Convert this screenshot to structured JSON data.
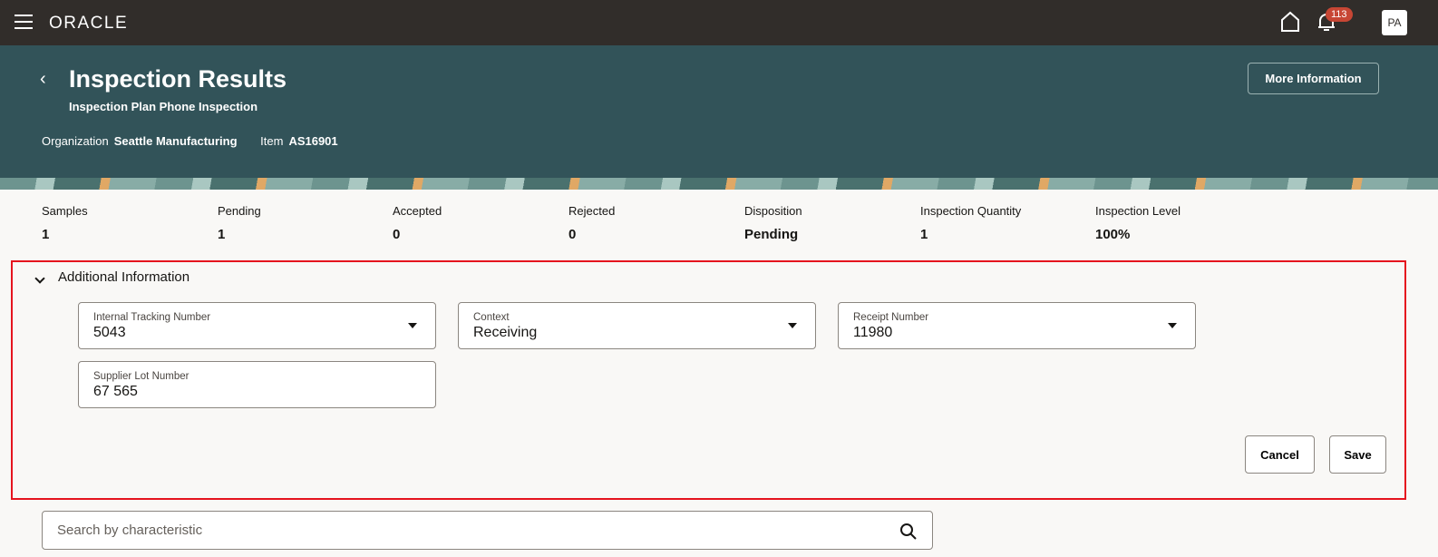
{
  "topbar": {
    "brand": "ORACLE",
    "notifications": "113",
    "user_initials": "PA"
  },
  "header": {
    "title": "Inspection Results",
    "subtitle": "Inspection Plan Phone Inspection",
    "org_label": "Organization",
    "org_value": "Seattle Manufacturing",
    "item_label": "Item",
    "item_value": "AS16901",
    "more_info": "More Information"
  },
  "stats": [
    {
      "label": "Samples",
      "value": "1"
    },
    {
      "label": "Pending",
      "value": "1"
    },
    {
      "label": "Accepted",
      "value": "0"
    },
    {
      "label": "Rejected",
      "value": "0"
    },
    {
      "label": "Disposition",
      "value": "Pending"
    },
    {
      "label": "Inspection Quantity",
      "value": "1"
    },
    {
      "label": "Inspection Level",
      "value": "100%"
    }
  ],
  "additional": {
    "title": "Additional Information",
    "fields": [
      {
        "label": "Internal Tracking Number",
        "value": "5043"
      },
      {
        "label": "Context",
        "value": "Receiving"
      },
      {
        "label": "Receipt Number",
        "value": "11980"
      },
      {
        "label": "Supplier Lot Number",
        "value": "67 565"
      }
    ],
    "cancel": "Cancel",
    "save": "Save"
  },
  "search": {
    "placeholder": "Search by characteristic"
  }
}
